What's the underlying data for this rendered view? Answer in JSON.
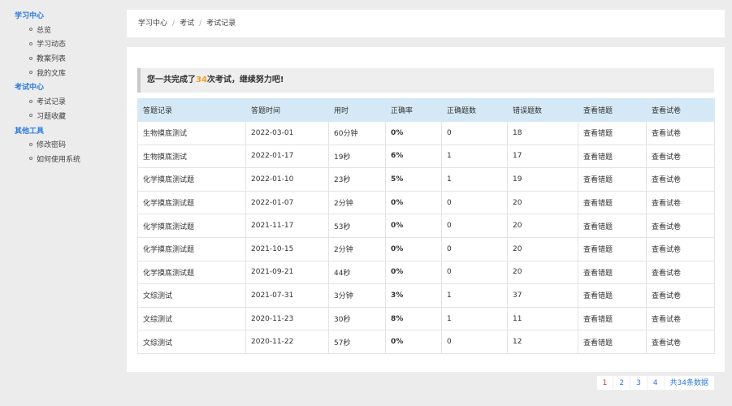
{
  "sidebar": {
    "groups": [
      {
        "title": "学习中心",
        "items": [
          "总览",
          "学习动态",
          "教案列表",
          "我的文库"
        ]
      },
      {
        "title": "考试中心",
        "items": [
          "考试记录",
          "习题收藏"
        ]
      },
      {
        "title": "其他工具",
        "items": [
          "修改密码",
          "如何使用系统"
        ]
      }
    ]
  },
  "breadcrumb": {
    "items": [
      "学习中心",
      "考试",
      "考试记录"
    ],
    "separator": "/"
  },
  "summary": {
    "prefix": "您一共完成了",
    "count": "34",
    "suffix": "次考试，继续努力吧!"
  },
  "table": {
    "headers": [
      "答题记录",
      "答题时间",
      "用时",
      "正确率",
      "正确题数",
      "错误题数",
      "查看错题",
      "查看试卷"
    ],
    "rows": [
      [
        "生物摸底测试",
        "2022-03-01",
        "60分钟",
        "0%",
        "0",
        "18",
        "查看错题",
        "查看试卷"
      ],
      [
        "生物摸底测试",
        "2022-01-17",
        "19秒",
        "6%",
        "1",
        "17",
        "查看错题",
        "查看试卷"
      ],
      [
        "化学摸底测试题",
        "2022-01-10",
        "23秒",
        "5%",
        "1",
        "19",
        "查看错题",
        "查看试卷"
      ],
      [
        "化学摸底测试题",
        "2022-01-07",
        "2分钟",
        "0%",
        "0",
        "20",
        "查看错题",
        "查看试卷"
      ],
      [
        "化学摸底测试题",
        "2021-11-17",
        "53秒",
        "0%",
        "0",
        "20",
        "查看错题",
        "查看试卷"
      ],
      [
        "化学摸底测试题",
        "2021-10-15",
        "2分钟",
        "0%",
        "0",
        "20",
        "查看错题",
        "查看试卷"
      ],
      [
        "化学摸底测试题",
        "2021-09-21",
        "44秒",
        "0%",
        "0",
        "20",
        "查看错题",
        "查看试卷"
      ],
      [
        "文综测试",
        "2021-07-31",
        "3分钟",
        "3%",
        "1",
        "37",
        "查看错题",
        "查看试卷"
      ],
      [
        "文综测试",
        "2020-11-23",
        "30秒",
        "8%",
        "1",
        "11",
        "查看错题",
        "查看试卷"
      ],
      [
        "文综测试",
        "2020-11-22",
        "57秒",
        "0%",
        "0",
        "12",
        "查看错题",
        "查看试卷"
      ]
    ]
  },
  "pagination": {
    "pages": [
      "1",
      "2",
      "3",
      "4"
    ],
    "current": "1",
    "total_label": "共34条数据"
  },
  "colors": {
    "accent": "#2a7ae2",
    "highlight": "#f0a020",
    "header_bg": "#d4e9f5",
    "active_page": "#e03030"
  }
}
